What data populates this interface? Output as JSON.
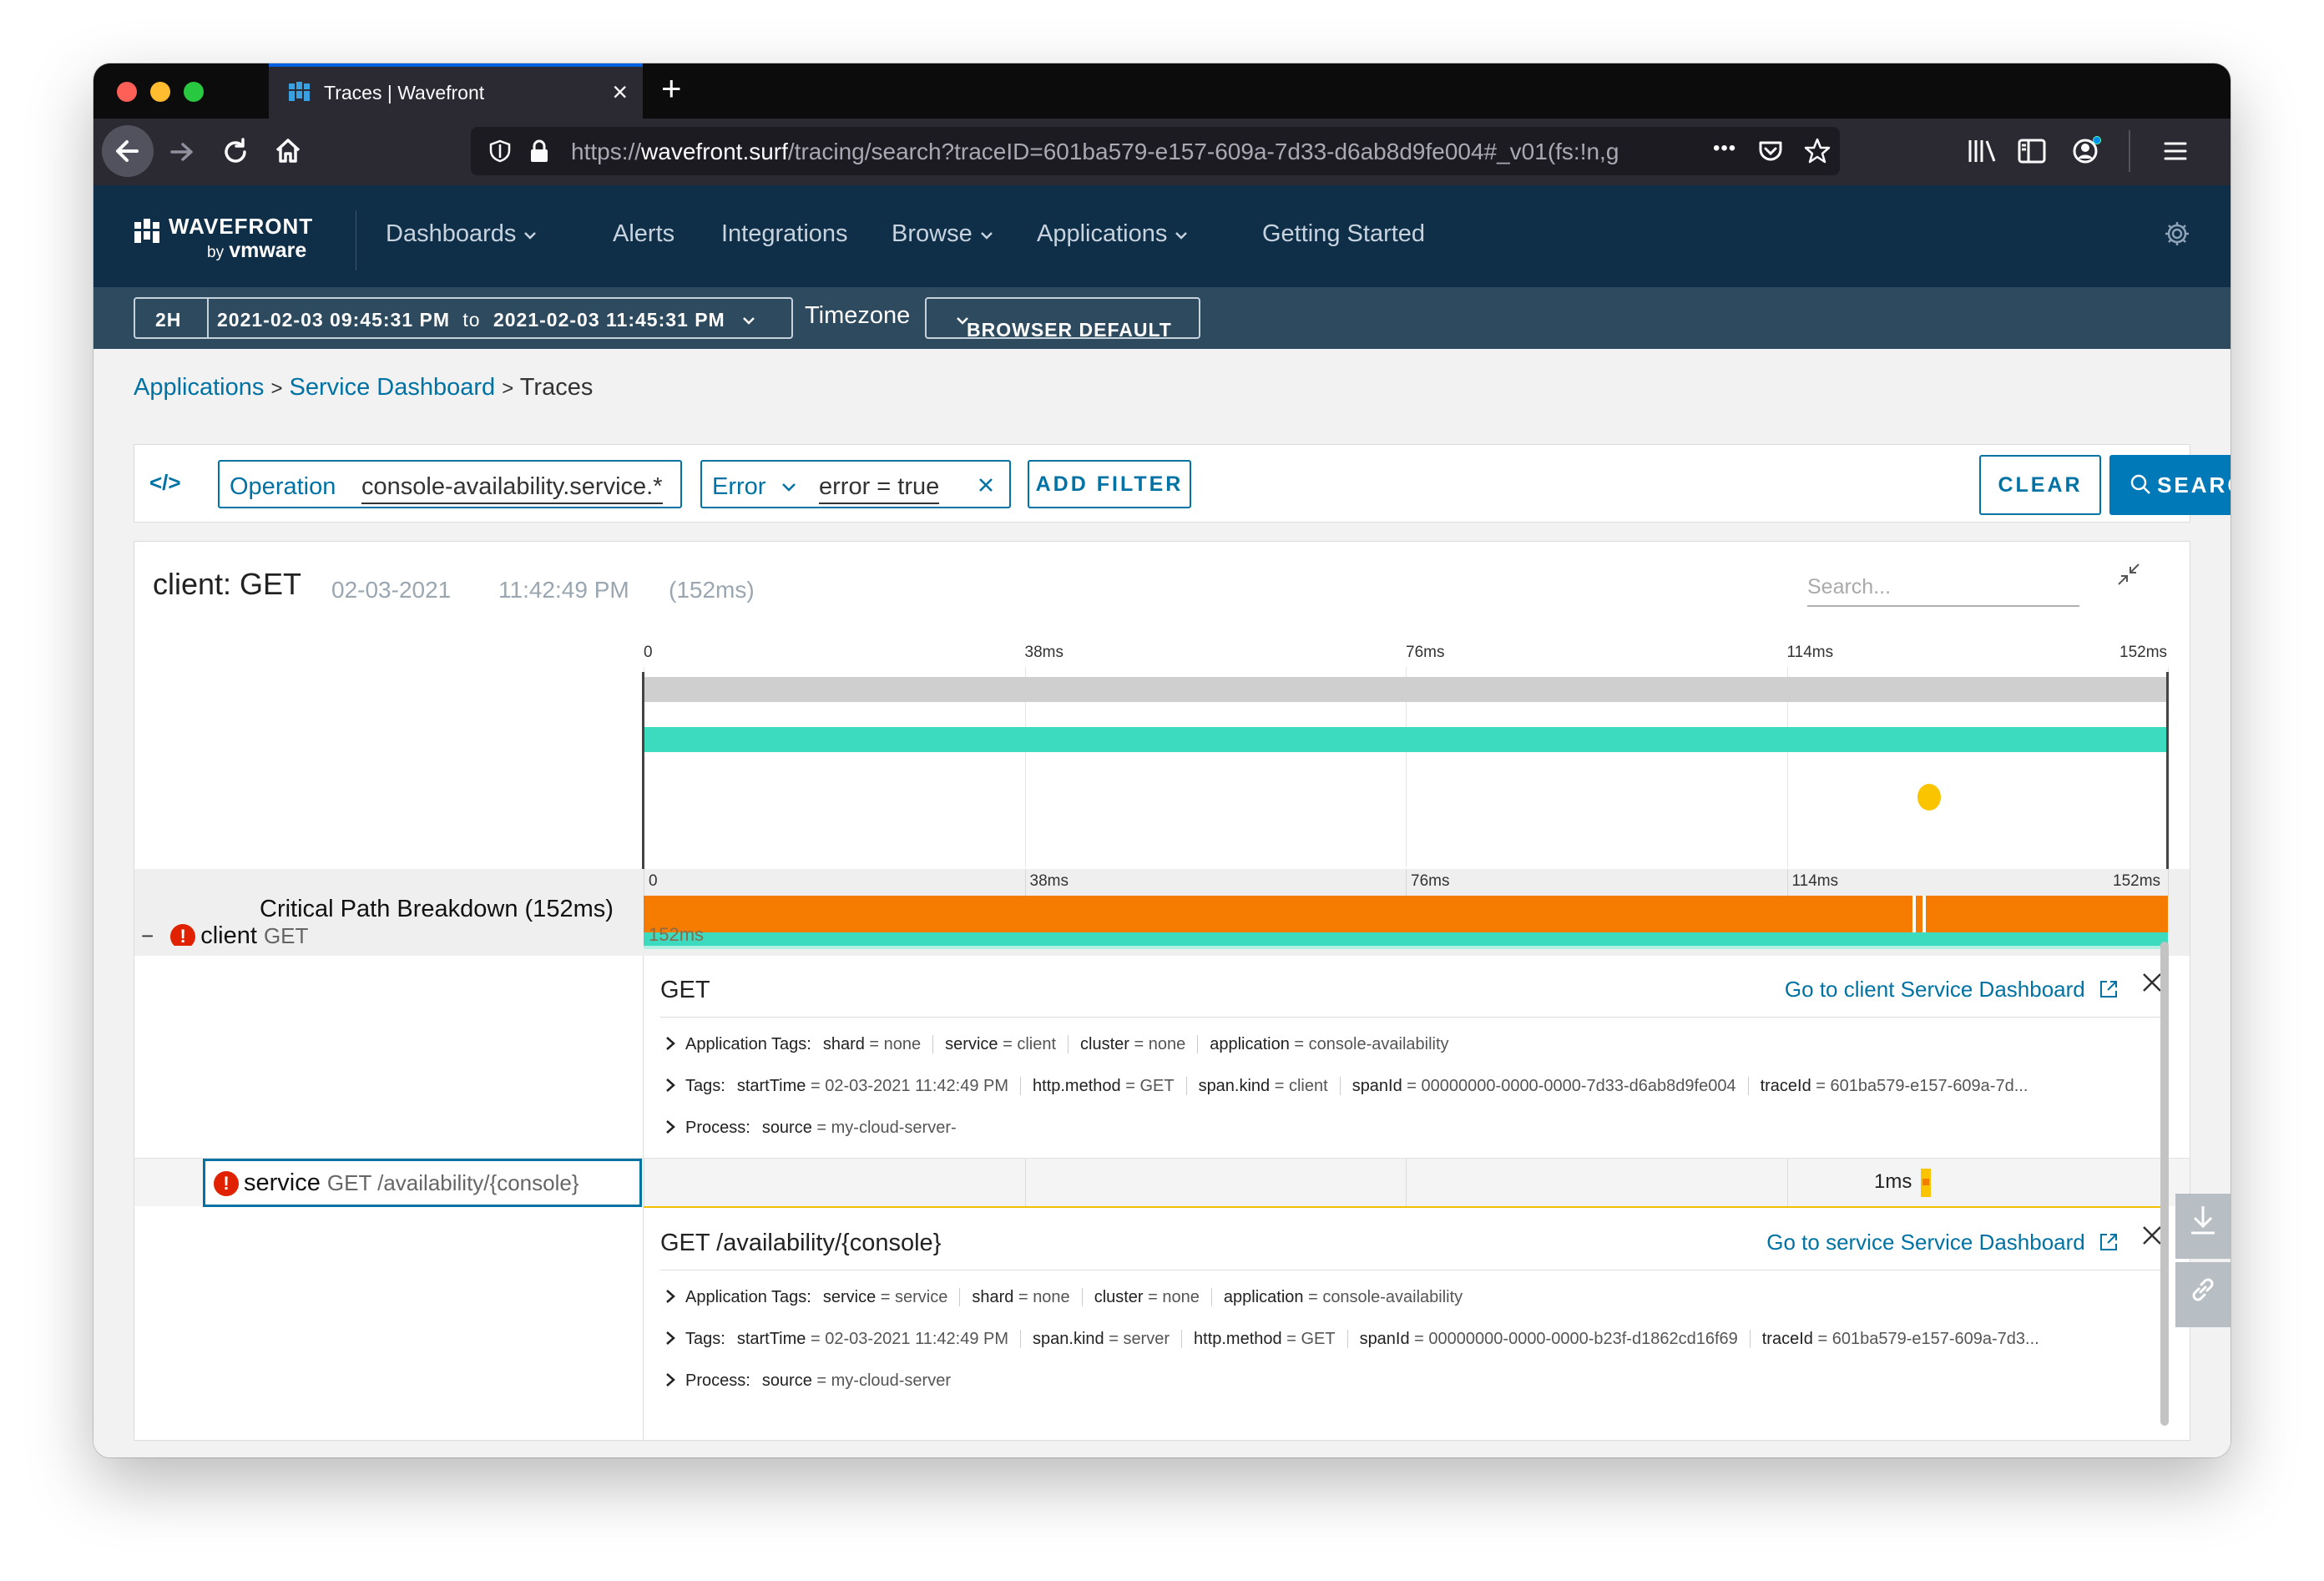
{
  "browser": {
    "tab_title": "Traces | Wavefront",
    "url_prefix": "https://",
    "url_host": "wavefront.surf",
    "url_path": "/tracing/search?traceID=601ba579-e157-609a-7d33-d6ab8d9fe004#_v01(fs:!n,g",
    "new_tab": "+",
    "more": "•••"
  },
  "header": {
    "logo": "WAVEFRONT",
    "logo_by": "by",
    "logo_vm": "vmware",
    "menu": [
      {
        "label": "Dashboards",
        "dropdown": true
      },
      {
        "label": "Alerts",
        "dropdown": false
      },
      {
        "label": "Integrations",
        "dropdown": false
      },
      {
        "label": "Browse",
        "dropdown": true
      },
      {
        "label": "Applications",
        "dropdown": true
      },
      {
        "label": "Getting Started",
        "dropdown": false
      }
    ]
  },
  "timebar": {
    "window": "2H",
    "start": "2021-02-03 09:45:31 PM",
    "to": "to",
    "end": "2021-02-03 11:45:31 PM",
    "timezone_label": "Timezone",
    "timezone_value": "BROWSER DEFAULT"
  },
  "breadcrumb": {
    "items": [
      "Applications",
      "Service Dashboard"
    ],
    "current": "Traces",
    "sep": ">"
  },
  "filters": {
    "code_icon": "</>",
    "operation_key": "Operation",
    "operation_value": "console-availability.service.*",
    "error_key": "Error",
    "error_value": "error = true",
    "add_filter": "ADD FILTER",
    "clear": "CLEAR",
    "search": "SEARCH"
  },
  "trace": {
    "title": "client: GET",
    "date": "02-03-2021",
    "time": "11:42:49 PM",
    "duration": "(152ms)",
    "search_placeholder": "Search...",
    "axis_ticks": [
      "0",
      "38ms",
      "76ms",
      "114ms",
      "152ms"
    ],
    "critical_path_title": "Critical Path Breakdown (152ms)",
    "critical_path_bar_label": "152ms",
    "total_ms": 152
  },
  "spans": [
    {
      "service": "client",
      "operation": "GET",
      "title": "GET",
      "dashboard_link": "Go to client Service Dashboard",
      "application_tags_label": "Application Tags:",
      "application_tags": [
        {
          "k": "shard",
          "v": "none"
        },
        {
          "k": "service",
          "v": "client"
        },
        {
          "k": "cluster",
          "v": "none"
        },
        {
          "k": "application",
          "v": "console-availability"
        }
      ],
      "tags_label": "Tags:",
      "tags": [
        {
          "k": "startTime",
          "v": "02-03-2021 11:42:49 PM"
        },
        {
          "k": "http.method",
          "v": "GET"
        },
        {
          "k": "span.kind",
          "v": "client"
        },
        {
          "k": "spanId",
          "v": "00000000-0000-0000-7d33-d6ab8d9fe004"
        },
        {
          "k": "traceId",
          "v": "601ba579-e157-609a-7d..."
        }
      ],
      "process_label": "Process:",
      "process": [
        {
          "k": "source",
          "v": "my-cloud-server-"
        }
      ]
    },
    {
      "service": "service",
      "operation": "GET /availability/{console}",
      "duration": "1ms",
      "title": "GET /availability/{console}",
      "dashboard_link": "Go to service Service Dashboard",
      "application_tags_label": "Application Tags:",
      "application_tags": [
        {
          "k": "service",
          "v": "service"
        },
        {
          "k": "shard",
          "v": "none"
        },
        {
          "k": "cluster",
          "v": "none"
        },
        {
          "k": "application",
          "v": "console-availability"
        }
      ],
      "tags_label": "Tags:",
      "tags": [
        {
          "k": "startTime",
          "v": "02-03-2021 11:42:49 PM"
        },
        {
          "k": "span.kind",
          "v": "server"
        },
        {
          "k": "http.method",
          "v": "GET"
        },
        {
          "k": "spanId",
          "v": "00000000-0000-0000-b23f-d1862cd16f69"
        },
        {
          "k": "traceId",
          "v": "601ba579-e157-609a-7d3..."
        }
      ],
      "process_label": "Process:",
      "process": [
        {
          "k": "source",
          "v": "my-cloud-server"
        }
      ]
    }
  ],
  "colors": {
    "header_bg": "#0f2e47",
    "timebar_bg": "#2e4a5f",
    "link": "#0072a3",
    "span_teal": "#3cdbc0",
    "critical_orange": "#f57c00",
    "error_red": "#e12200",
    "marker_yellow": "#fac400"
  }
}
